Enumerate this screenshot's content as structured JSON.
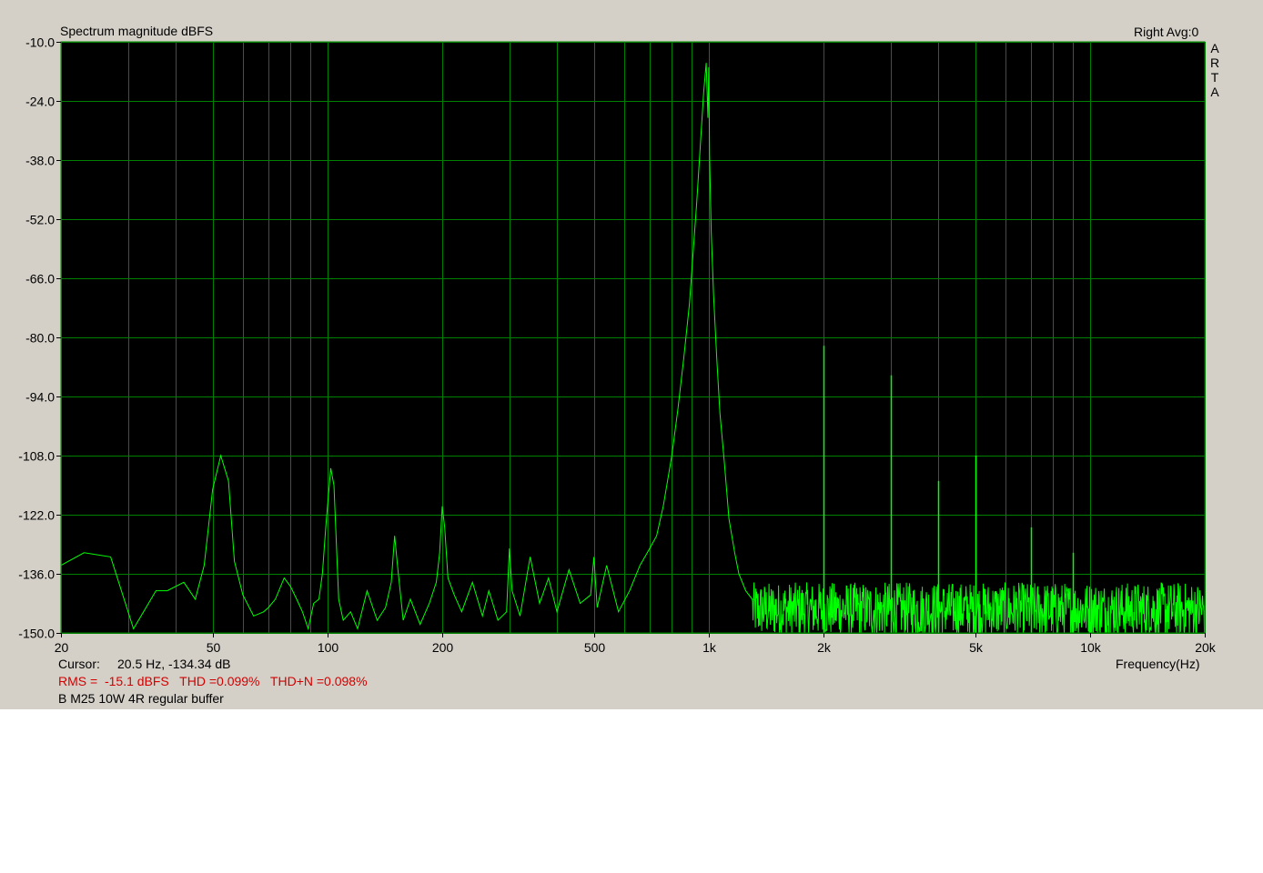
{
  "header": {
    "title": "Spectrum magnitude dBFS",
    "channel": "Right  Avg:0",
    "vertical_label": [
      "A",
      "R",
      "T",
      "A"
    ]
  },
  "footer": {
    "cursor_label": "Cursor:",
    "cursor_value": "20.5 Hz, -134.34 dB",
    "stats": "RMS =  -15.1 dBFS   THD =0.099%   THD+N =0.098%",
    "description": "B M25 10W 4R regular buffer",
    "xlabel": "Frequency(Hz)"
  },
  "colors": {
    "window_bg": "#d4d0c8",
    "plot_bg": "#000000",
    "grid": "#008000",
    "trace": "#00ff00",
    "stats_text": "#d40000"
  },
  "chart_data": {
    "type": "line",
    "title": "Spectrum magnitude dBFS",
    "xlabel": "Frequency(Hz)",
    "ylabel": "",
    "xscale": "log",
    "xlim": [
      20,
      20000
    ],
    "ylim": [
      -150,
      -10
    ],
    "grid": true,
    "xticks": [
      {
        "value": 20,
        "label": "20"
      },
      {
        "value": 50,
        "label": "50"
      },
      {
        "value": 100,
        "label": "100"
      },
      {
        "value": 200,
        "label": "200"
      },
      {
        "value": 500,
        "label": "500"
      },
      {
        "value": 1000,
        "label": "1k"
      },
      {
        "value": 2000,
        "label": "2k"
      },
      {
        "value": 5000,
        "label": "5k"
      },
      {
        "value": 10000,
        "label": "10k"
      },
      {
        "value": 20000,
        "label": "20k"
      }
    ],
    "xgrid": [
      30,
      40,
      60,
      70,
      80,
      90,
      300,
      400,
      600,
      700,
      800,
      900,
      3000,
      4000,
      6000,
      7000,
      8000,
      9000
    ],
    "yticks": [
      {
        "value": -10,
        "label": "-10.0"
      },
      {
        "value": -24,
        "label": "-24.0"
      },
      {
        "value": -38,
        "label": "-38.0"
      },
      {
        "value": -52,
        "label": "-52.0"
      },
      {
        "value": -66,
        "label": "-66.0"
      },
      {
        "value": -80,
        "label": "-80.0"
      },
      {
        "value": -94,
        "label": "-94.0"
      },
      {
        "value": -108,
        "label": "-108.0"
      },
      {
        "value": -122,
        "label": "-122.0"
      },
      {
        "value": -136,
        "label": "-136.0"
      },
      {
        "value": -150,
        "label": "-150.0"
      }
    ],
    "series": [
      {
        "x": [
          20,
          23,
          27,
          31,
          35.5,
          38,
          42,
          45,
          47.5,
          50,
          52.5,
          55,
          57,
          60,
          64,
          68,
          70,
          73,
          77,
          80,
          83,
          86,
          89,
          92,
          95,
          97,
          99,
          100,
          102,
          104,
          107,
          110,
          115,
          120,
          127,
          135,
          142,
          147,
          150,
          153,
          158,
          165,
          175,
          185,
          193,
          197,
          200,
          203,
          207,
          215,
          225,
          240,
          255,
          265,
          280,
          295,
          300,
          305,
          320,
          340,
          360,
          380,
          400,
          430,
          460,
          490,
          500,
          510,
          540,
          580,
          620,
          660,
          700,
          730,
          760,
          800,
          830,
          860,
          890,
          910,
          930,
          950,
          970,
          985,
          995,
          1000,
          1005,
          1015,
          1030,
          1050,
          1070,
          1100,
          1130,
          1170,
          1200,
          1250,
          1300
        ],
        "y": [
          -134,
          -131,
          -132,
          -149,
          -140,
          -140,
          -138,
          -142,
          -134,
          -116,
          -108,
          -114,
          -133,
          -141,
          -146,
          -145,
          -144,
          -142,
          -137,
          -139,
          -142,
          -145,
          -149,
          -143,
          -142,
          -136,
          -125,
          -120,
          -111,
          -115,
          -142,
          -147,
          -145,
          -149,
          -140,
          -147,
          -144,
          -138,
          -127,
          -135,
          -147,
          -142,
          -148,
          -143,
          -138,
          -131,
          -120,
          -125,
          -137,
          -141,
          -145,
          -138,
          -146,
          -140,
          -147,
          -145,
          -130,
          -140,
          -146,
          -132,
          -143,
          -137,
          -145,
          -135,
          -143,
          -141,
          -132,
          -144,
          -134,
          -145,
          -140,
          -134,
          -130,
          -127,
          -120,
          -108,
          -97,
          -85,
          -72,
          -60,
          -48,
          -35,
          -22,
          -15,
          -28,
          -16,
          -37,
          -55,
          -70,
          -85,
          -98,
          -110,
          -123,
          -131,
          -136,
          -140,
          -142
        ]
      }
    ],
    "harmonics": [
      {
        "x": 2000,
        "y": -82
      },
      {
        "x": 3000,
        "y": -89
      },
      {
        "x": 4000,
        "y": -114
      },
      {
        "x": 5000,
        "y": -108
      },
      {
        "x": 7000,
        "y": -125
      },
      {
        "x": 9000,
        "y": -131
      }
    ],
    "noise_floor_db": [
      -151,
      -138
    ]
  }
}
